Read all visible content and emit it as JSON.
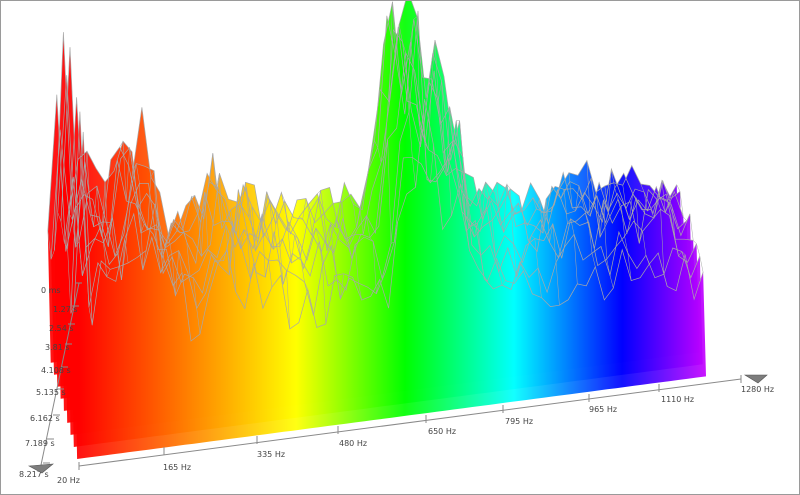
{
  "chart_data": {
    "type": "waterfall",
    "title": "",
    "xlabel": "",
    "ylabel": "",
    "x_unit": "Hz",
    "x_ticks": [
      "20 Hz",
      "165 Hz",
      "335 Hz",
      "480 Hz",
      "650 Hz",
      "795 Hz",
      "965 Hz",
      "1110 Hz",
      "1280 Hz"
    ],
    "z_ticks": [
      "0 ms",
      "1.27 s",
      "2.54 s",
      "3.81 s",
      "4.108 s",
      "5.135 s",
      "6.162 s",
      "7.189 s",
      "8.217 s"
    ],
    "x_range": [
      20,
      1280
    ],
    "z_range_s": [
      0,
      8.217
    ],
    "color_scale": [
      "#ff0000",
      "#ff8000",
      "#ffff00",
      "#00ff00",
      "#00ffff",
      "#0000ff",
      "#ff00ff"
    ],
    "mesh_color": "#a8a8a8",
    "peak_profile": {
      "freq_hz": [
        20,
        35,
        50,
        75,
        100,
        130,
        165,
        200,
        250,
        300,
        335,
        380,
        430,
        480,
        530,
        580,
        630,
        650,
        680,
        700,
        720,
        750,
        780,
        795,
        830,
        880,
        930,
        965,
        1000,
        1050,
        1110,
        1160,
        1200,
        1240
      ],
      "level": [
        0.45,
        1.0,
        0.42,
        0.62,
        0.55,
        0.5,
        0.75,
        0.48,
        0.42,
        0.47,
        0.55,
        0.45,
        0.4,
        0.38,
        0.42,
        0.38,
        0.45,
        0.88,
        0.95,
        0.82,
        0.8,
        0.72,
        0.6,
        0.42,
        0.38,
        0.36,
        0.34,
        0.35,
        0.38,
        0.36,
        0.35,
        0.34,
        0.3,
        0.25
      ]
    }
  }
}
